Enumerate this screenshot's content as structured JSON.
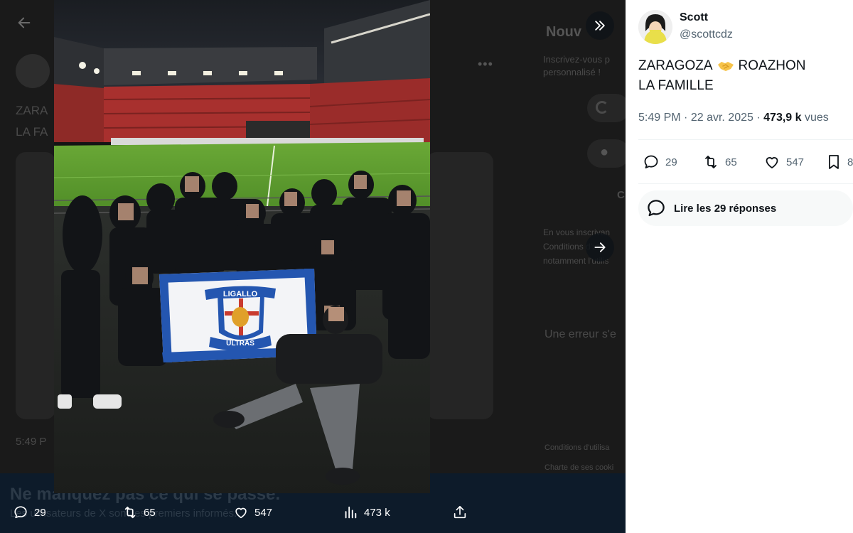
{
  "background": {
    "tweet_line1": "ZARA",
    "tweet_line2": "LA FA",
    "time_partial": "5:49 P",
    "right_title": "Nouv",
    "right_line1": "Inscrivez-vous p",
    "right_line2": "personnalisé !",
    "right_c": "C",
    "right_p1": "En vous inscrivan",
    "right_p2": "Conditions d'utili",
    "right_p3": "notamment l'utilis",
    "error_text": "Une erreur s'e",
    "footer1": "Conditions d'utilisa",
    "footer2": "Charte de ses cooki",
    "banner_title": "Ne manquez pas ce qui se passe.",
    "banner_subtitle": "Les utilisateurs de X sont les premiers informés."
  },
  "media": {
    "flag_top": "LIGALLO",
    "flag_bottom": "ULTRAS",
    "actions": {
      "replies": "29",
      "retweets": "65",
      "likes": "547",
      "views": "473 k"
    }
  },
  "tweet": {
    "author_name": "Scott",
    "author_handle": "@scottcdz",
    "line1_left": "ZARAGOZA",
    "line1_emoji": "handshake",
    "line1_right": "ROAZHON",
    "line2": "LA FAMILLE",
    "time": "5:49 PM",
    "dot": "·",
    "date": "22 avr. 2025",
    "dot2": "·",
    "views_count": "473,9 k",
    "views_label": "vues",
    "replies": "29",
    "retweets": "65",
    "likes": "547",
    "bookmarks": "8",
    "read_replies": "Lire les 29 réponses"
  },
  "colors": {
    "text_primary": "#0f1419",
    "text_secondary": "#536471",
    "flag_blue": "#2456b0",
    "pitch_green": "#5f9e2f",
    "stand_red": "#a8302e"
  }
}
